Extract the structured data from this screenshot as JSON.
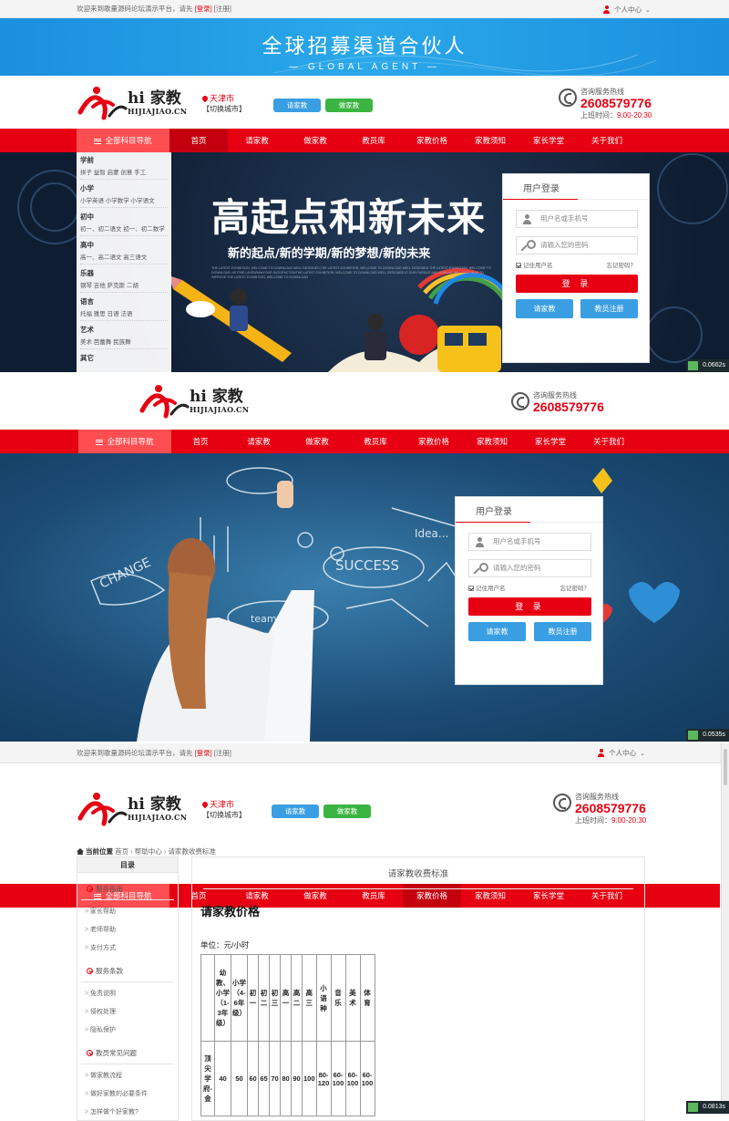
{
  "topbar": {
    "welcome": "欢迎来到歌量源码论坛演示平台，请先",
    "login": "[登录]",
    "register": "[注册]",
    "user_center": "个人中心"
  },
  "banner": {
    "title": "全球招募渠道合伙人",
    "subtitle": "— GLOBAL AGENT —"
  },
  "logo": {
    "name": "hi 家教",
    "domain": "HIJIAJIAO.CN"
  },
  "city": {
    "name": "天津市",
    "switch": "【切换城市】"
  },
  "header_buttons": {
    "request": "请家教",
    "teach": "做家教"
  },
  "hotline": {
    "label": "咨询服务热线",
    "number": "2608579776",
    "hours_label": "上班时间：",
    "hours": "9:00-20:30"
  },
  "nav": {
    "category": "全部科目导航",
    "items": [
      "首页",
      "请家教",
      "做家教",
      "教员库",
      "家教价格",
      "家教须知",
      "家长学堂",
      "关于我们"
    ]
  },
  "hero1": {
    "headline": "高起点和新未来",
    "subline": "新的起点/新的学期/新的梦想/新的未来",
    "fineprint": "THE LATEST EXHIBITION, WELCOME TO DOWNLOAD WELL DESIGNED,THE LATEST EXHIBITION, WELCOME TO DOWNLOAD WELL DESIGNED THE LATEST EXHIBITION, WELCOME TO DOWNLOAD. HE FINE LAYEDRAWYOUR SATISFACTIONTHE LATEST EXHIBITION, WELCOME TO DOWNLOAD WELL DESIGNED IS OUR PURSUIT AND GOALWE WILL CONTINUE TO IMPROVE THE LATEST EXHIBITION, WELCOME TO DOWNLOAD"
  },
  "side_categories": [
    {
      "group": "学前",
      "items": "拼子 益智 启蒙 创意 手工"
    },
    {
      "group": "小学",
      "items": "小学英语 小学数学 小学语文"
    },
    {
      "group": "初中",
      "items": "初一、初二语文 初一、初二数学"
    },
    {
      "group": "高中",
      "items": "高一、高二语文 高三语文"
    },
    {
      "group": "乐器",
      "items": "钢琴 吉他 萨克斯 二胡"
    },
    {
      "group": "语言",
      "items": "托福 雅思 日语 法语"
    },
    {
      "group": "艺术",
      "items": "美术 芭蕾舞 民族舞"
    },
    {
      "group": "其它",
      "items": ""
    }
  ],
  "login": {
    "title": "用户登录",
    "user_placeholder": "用户名或手机号",
    "pass_placeholder": "请输入您的密码",
    "remember": "记住用户名",
    "forgot": "忘记密码？",
    "submit": "登 录",
    "request": "请家教",
    "register": "教员注册"
  },
  "timers": [
    "0.0662s",
    "0.0535s",
    "0.0813s"
  ],
  "page3": {
    "breadcrumb_label": "当前位置",
    "breadcrumb": "首页 › 帮助中心 › 请家教收费标准",
    "menu_title": "目录",
    "groups": [
      {
        "title": "服务指南",
        "items": [
          "家长帮助",
          "老师帮助",
          "支付方式"
        ]
      },
      {
        "title": "服务条款",
        "items": [
          "免责说明",
          "侵权处理",
          "隐私保护"
        ]
      },
      {
        "title": "教员常见问题",
        "items": [
          "做家教流程",
          "做好家教的必要条件",
          "怎样做个好家教?"
        ]
      }
    ],
    "content_title": "请家教收费标准",
    "heading": "请家教价格",
    "unit": "单位：元/小时",
    "table": {
      "headers": [
        "幼教、小学（1-3年级）",
        "小学（4-6年级）",
        "初一",
        "初二",
        "初三",
        "高一",
        "高二",
        "高三",
        "小语种",
        "音乐",
        "美术",
        "体育"
      ],
      "row_label": "顶尖学府-金",
      "values": [
        "40",
        "50",
        "60",
        "65",
        "70",
        "80",
        "90",
        "100",
        "80-120",
        "60-100",
        "60-100",
        "60-100"
      ]
    }
  }
}
